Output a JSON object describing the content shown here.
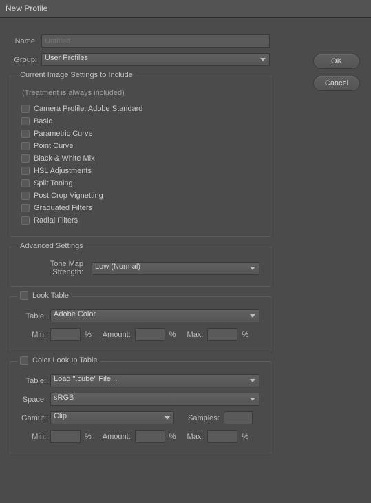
{
  "title": "New Profile",
  "buttons": {
    "ok": "OK",
    "cancel": "Cancel"
  },
  "form": {
    "name_label": "Name:",
    "name_placeholder": "Untitled",
    "group_label": "Group:",
    "group_value": "User Profiles"
  },
  "include": {
    "legend": "Current Image Settings to Include",
    "note": "(Treatment is always included)",
    "items": [
      "Camera Profile: Adobe Standard",
      "Basic",
      "Parametric Curve",
      "Point Curve",
      "Black & White Mix",
      "HSL Adjustments",
      "Split Toning",
      "Post Crop Vignetting",
      "Graduated Filters",
      "Radial Filters"
    ]
  },
  "advanced": {
    "legend": "Advanced Settings",
    "tone_label": "Tone Map Strength:",
    "tone_value": "Low (Normal)"
  },
  "look": {
    "legend": "Look Table",
    "table_label": "Table:",
    "table_value": "Adobe Color",
    "min_label": "Min:",
    "amount_label": "Amount:",
    "max_label": "Max:",
    "pct": "%"
  },
  "clut": {
    "legend": "Color Lookup Table",
    "table_label": "Table:",
    "table_value": "Load \".cube\" File...",
    "space_label": "Space:",
    "space_value": "sRGB",
    "gamut_label": "Gamut:",
    "gamut_value": "Clip",
    "samples_label": "Samples:",
    "min_label": "Min:",
    "amount_label": "Amount:",
    "max_label": "Max:",
    "pct": "%"
  }
}
